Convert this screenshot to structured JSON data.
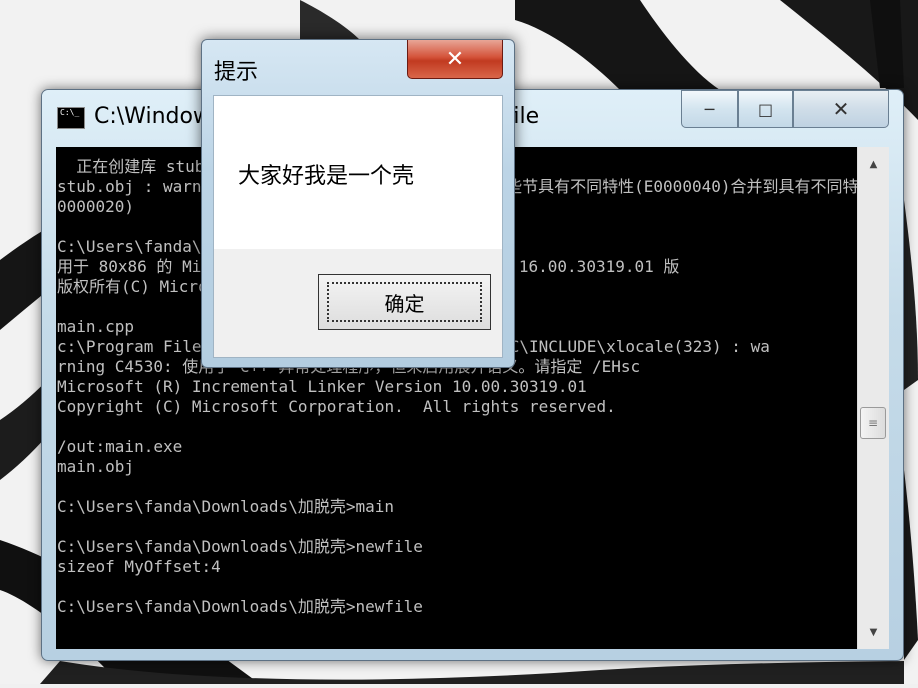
{
  "console_window": {
    "title": "C:\\Windows\\system32\\cmd.exe - newfile",
    "icon": "cmd-icon",
    "icon_text": "C:\\_",
    "minimize": "─",
    "maximize": "□",
    "close": "✕",
    "scroll_up": "▲",
    "scroll_down": "▼",
    "thumb_grip": "≡",
    "text": "  正在创建库 stub.lib 和对象 stub.exp\nstub.obj : warning LNK4078: 找到多个“.text”节，这些节具有不同特性(E0000040)合并到具有不同特性的“.text”(6\n0000020)\n\nC:\\Users\\fanda\\Downloads\\加脱壳>cl main.cpp\n用于 80x86 的 Microsoft (R) 32 位 C/C++ 优化编译器 16.00.30319.01 版\n版权所有(C) Microsoft Corporation。保留所有权利。\n\nmain.cpp\nc:\\Program Files\\Microsoft Visual Studio 10.0\\VC\\INCLUDE\\xlocale(323) : wa\nrning C4530: 使用了 C++ 异常处理程序，但未启用展开语义。请指定 /EHsc\nMicrosoft (R) Incremental Linker Version 10.00.30319.01\nCopyright (C) Microsoft Corporation.  All rights reserved.\n\n/out:main.exe\nmain.obj\n\nC:\\Users\\fanda\\Downloads\\加脱壳>main\n\nC:\\Users\\fanda\\Downloads\\加脱壳>newfile\nsizeof MyOffset:4\n\nC:\\Users\\fanda\\Downloads\\加脱壳>newfile"
  },
  "dialog": {
    "title": "提示",
    "close": "✕",
    "message": "大家好我是一个壳",
    "ok_label": "确定"
  },
  "colors": {
    "console_bg": "#000000",
    "console_text": "#c0c0c0",
    "close_red": "#c83c22"
  }
}
